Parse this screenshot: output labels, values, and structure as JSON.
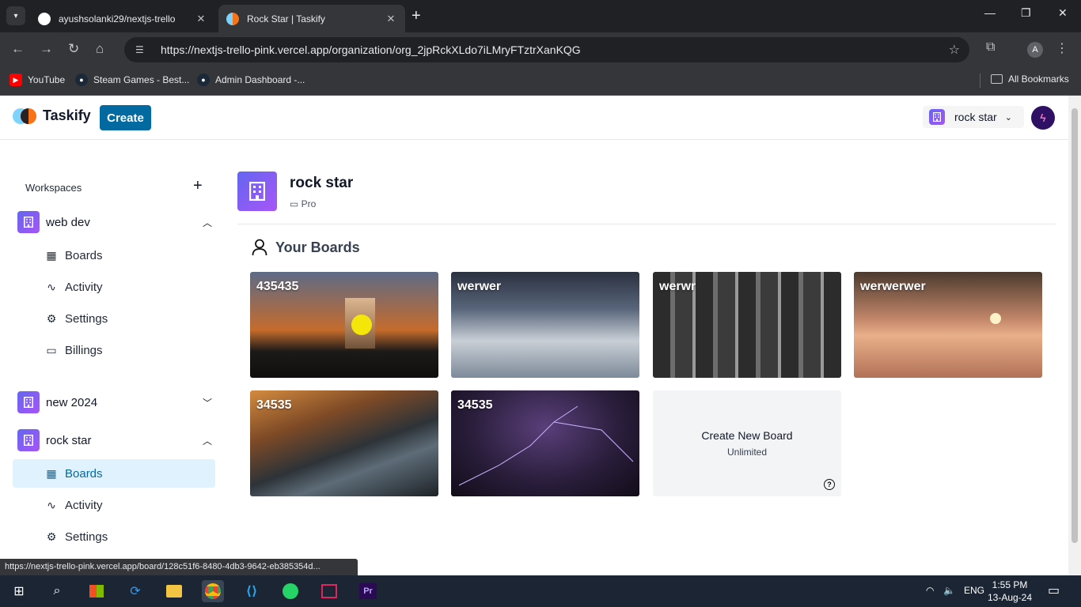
{
  "browser": {
    "tabs": [
      {
        "title": "ayushsolanki29/nextjs-trello",
        "active": false
      },
      {
        "title": "Rock Star | Taskify",
        "active": true
      }
    ],
    "url": "https://nextjs-trello-pink.vercel.app/organization/org_2jpRckXLdo7iLMryFTztrXanKQG",
    "profile_initial": "A",
    "bookmarks": [
      "YouTube",
      "Steam Games - Best...",
      "Admin Dashboard -..."
    ],
    "all_bookmarks": "All Bookmarks",
    "status_url": "https://nextjs-trello-pink.vercel.app/board/128c51f6-8480-4db3-9642-eb385354d..."
  },
  "app": {
    "logo": "Taskify",
    "create_label": "Create",
    "org_switcher": "rock star",
    "avatar_initial": "ϟ"
  },
  "sidebar": {
    "heading": "Workspaces",
    "orgs": [
      {
        "name": "web dev",
        "expanded": true,
        "items": [
          "Boards",
          "Activity",
          "Settings",
          "Billings"
        ]
      },
      {
        "name": "new 2024",
        "expanded": false
      },
      {
        "name": "rock star",
        "expanded": true,
        "items": [
          "Boards",
          "Activity",
          "Settings"
        ],
        "active_item": "Boards"
      }
    ]
  },
  "main": {
    "org_name": "rock star",
    "plan": "Pro",
    "section_title": "Your Boards",
    "boards": [
      {
        "title": "435435",
        "bg": "sunset"
      },
      {
        "title": "werwer",
        "bg": "mountains"
      },
      {
        "title": "werwr",
        "bg": "buildings"
      },
      {
        "title": "werwerwer",
        "bg": "palms"
      },
      {
        "title": "34535",
        "bg": "river"
      },
      {
        "title": "34535",
        "bg": "lightning"
      }
    ],
    "new_board": {
      "title": "Create New Board",
      "subtitle": "Unlimited",
      "help": "?"
    }
  },
  "taskbar": {
    "lang": "ENG",
    "time": "1:55 PM",
    "date": "13-Aug-24"
  },
  "colors": {
    "accent": "#0369a1",
    "org_icon": "#8b5cf6"
  }
}
